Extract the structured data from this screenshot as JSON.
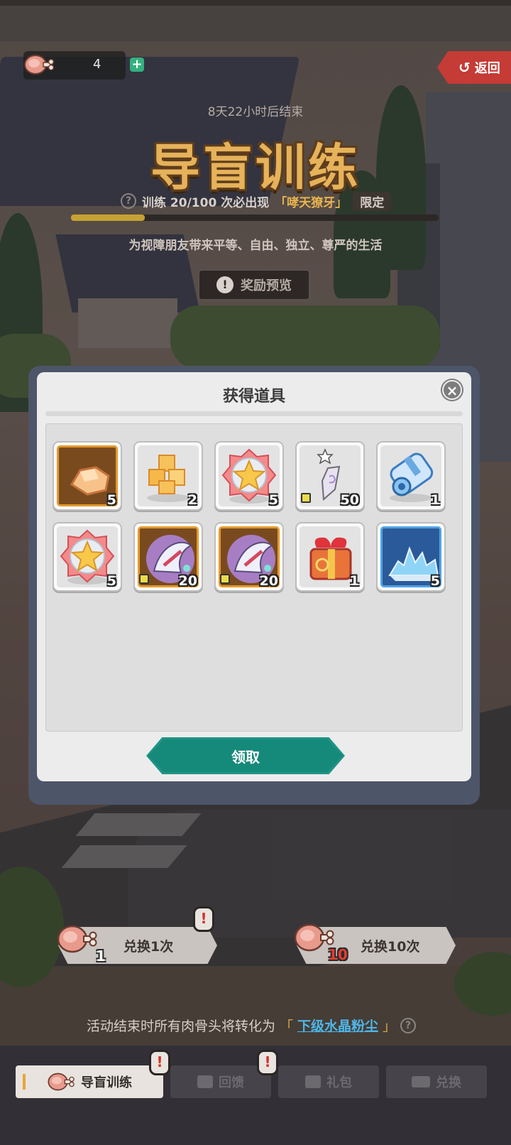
{
  "header": {
    "currency_count": "4",
    "currency_plus": "+",
    "back_label": "返回",
    "back_arrow": "↺"
  },
  "event": {
    "countdown": "8天22小时后结束",
    "title": "导盲训练",
    "train_text": "训练 20/100 次必出现",
    "pet_name": "「哮天獠牙」",
    "limit_badge": "限定",
    "progress_fraction": 0.2,
    "slogan": "为视障朋友带来平等、自由、独立、尊严的生活",
    "preview_label": "奖励预览"
  },
  "modal": {
    "title": "获得道具",
    "close": "×",
    "claim_label": "领取",
    "items": [
      {
        "icon": "gold-ore-icon",
        "frame": "orange",
        "qty": "5",
        "shard": false
      },
      {
        "icon": "gold-cubes-icon",
        "frame": "plain",
        "qty": "2",
        "shard": false
      },
      {
        "icon": "star-medal-icon",
        "frame": "plain",
        "qty": "5",
        "shard": false
      },
      {
        "icon": "crystal-pendant-icon",
        "frame": "plain",
        "qty": "50",
        "shard": true
      },
      {
        "icon": "blue-scroll-icon",
        "frame": "plain",
        "qty": "1",
        "shard": false
      },
      {
        "icon": "star-medal-icon",
        "frame": "plain",
        "qty": "5",
        "shard": false
      },
      {
        "icon": "dragon-pet-icon",
        "frame": "orange",
        "qty": "20",
        "shard": true
      },
      {
        "icon": "dragon-pet-icon",
        "frame": "orange",
        "qty": "20",
        "shard": true
      },
      {
        "icon": "gift-box-icon",
        "frame": "plain",
        "qty": "1",
        "shard": false
      },
      {
        "icon": "blue-crystal-dust-icon",
        "frame": "blue",
        "qty": "5",
        "shard": false
      }
    ]
  },
  "exchange": {
    "once_label": "兑换1次",
    "once_cost": "1",
    "ten_label": "兑换10次",
    "ten_cost": "10"
  },
  "footer_note": {
    "text": "活动结束时所有肉骨头将转化为",
    "bracket_open": "「",
    "highlight": "下级水晶粉尘",
    "bracket_close": "」",
    "help": "?"
  },
  "tabs": [
    {
      "label": "导盲训练",
      "active": true
    },
    {
      "label": "回馈",
      "active": false
    },
    {
      "label": "礼包",
      "active": false
    },
    {
      "label": "兑换",
      "active": false
    }
  ],
  "colors": {
    "accent_teal": "#15897a",
    "title_gold": "#e6b25a",
    "back_red": "#c53b35",
    "progress_gold": "#c6a233",
    "highlight_blue": "#4fb6e8"
  }
}
